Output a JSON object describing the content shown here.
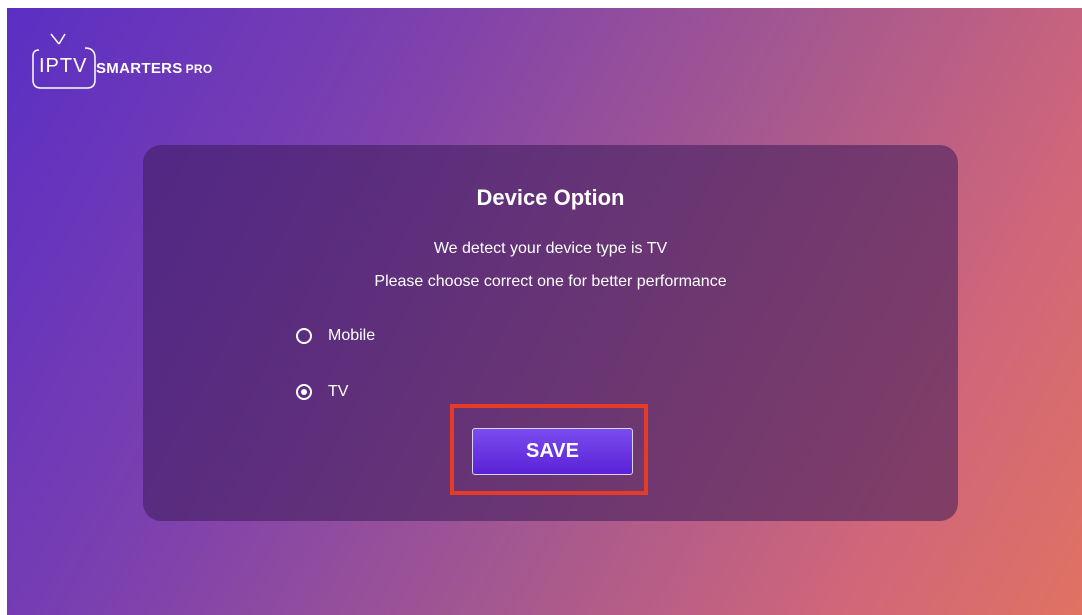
{
  "logo": {
    "prefix": "IPTV",
    "brand": "SMARTERS",
    "suffix": "PRO"
  },
  "dialog": {
    "title": "Device Option",
    "message_line1": "We detect your device type is TV",
    "message_line2": "Please choose correct one for better performance",
    "options": [
      {
        "label": "Mobile",
        "selected": false
      },
      {
        "label": "TV",
        "selected": true
      }
    ],
    "save_label": "SAVE"
  },
  "colors": {
    "highlight": "#e63b26",
    "button": "#6a33e3"
  },
  "icons": [
    "tv-icon",
    "radio-unchecked-icon",
    "radio-checked-icon"
  ]
}
